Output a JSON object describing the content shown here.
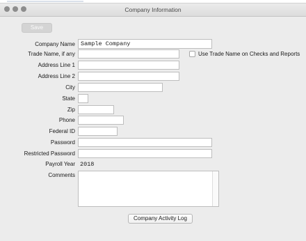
{
  "window": {
    "title": "Company Information"
  },
  "toolbar": {
    "save_label": "Save"
  },
  "form": {
    "company_name": {
      "label": "Company Name",
      "value": "Sample Company"
    },
    "trade_name": {
      "label": "Trade Name, if any",
      "value": ""
    },
    "use_trade_name": {
      "label": "Use Trade Name on Checks and Reports",
      "checked": false
    },
    "address1": {
      "label": "Address Line 1",
      "value": ""
    },
    "address2": {
      "label": "Address Line 2",
      "value": ""
    },
    "city": {
      "label": "City",
      "value": ""
    },
    "state": {
      "label": "State",
      "value": ""
    },
    "zip": {
      "label": "Zip",
      "value": ""
    },
    "phone": {
      "label": "Phone",
      "value": ""
    },
    "federal_id": {
      "label": "Federal ID",
      "value": ""
    },
    "password": {
      "label": "Password",
      "value": ""
    },
    "restricted_password": {
      "label": "Restricted Password",
      "value": ""
    },
    "payroll_year": {
      "label": "Payroll Year",
      "value": "2018"
    },
    "comments": {
      "label": "Comments",
      "value": ""
    }
  },
  "footer": {
    "activity_log_label": "Company Activity Log"
  }
}
